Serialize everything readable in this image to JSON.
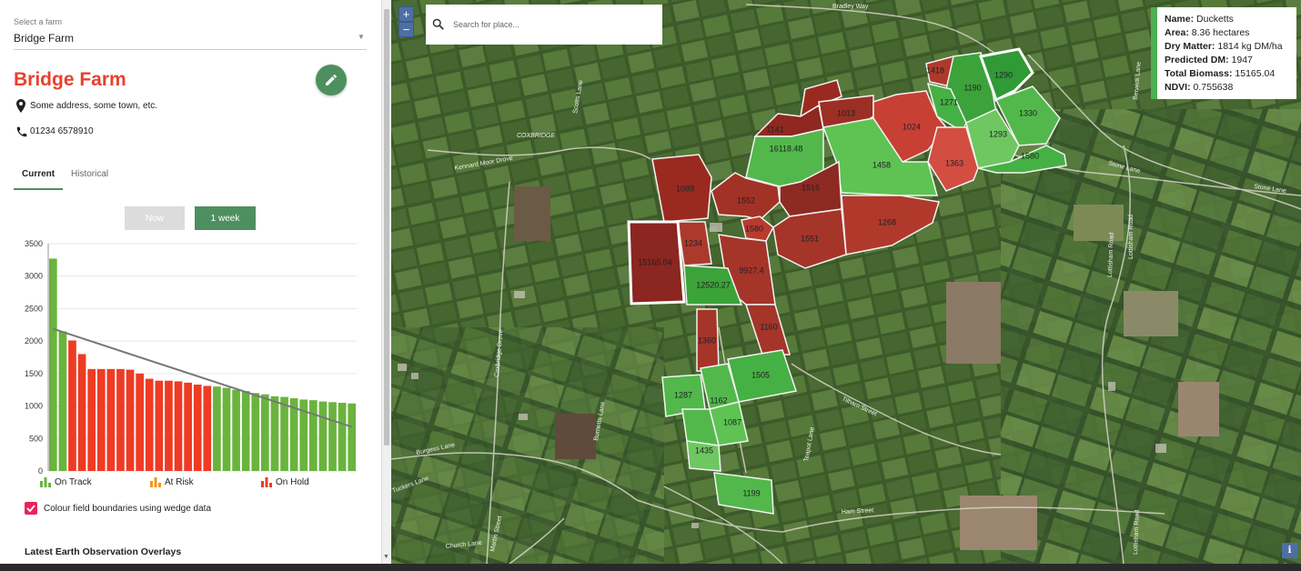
{
  "farm_select": {
    "label": "Select a farm",
    "value": "Bridge Farm"
  },
  "farm": {
    "title": "Bridge Farm",
    "address": "Some address, some town, etc.",
    "phone": "01234 6578910"
  },
  "tabs": [
    {
      "label": "Current",
      "active": true
    },
    {
      "label": "Historical",
      "active": false
    }
  ],
  "buttons": {
    "now": "Now",
    "week": "1 week"
  },
  "chart_data": {
    "type": "bar",
    "ylim": [
      0,
      3500
    ],
    "yticks": [
      "0",
      "500",
      "1000",
      "1500",
      "2000",
      "2500",
      "3000",
      "3500"
    ],
    "values": [
      3270,
      2150,
      2010,
      1800,
      1570,
      1570,
      1570,
      1570,
      1560,
      1500,
      1420,
      1390,
      1390,
      1380,
      1360,
      1330,
      1310,
      1300,
      1280,
      1250,
      1230,
      1200,
      1180,
      1150,
      1140,
      1120,
      1100,
      1090,
      1070,
      1060,
      1050,
      1040
    ],
    "statuses": [
      "green",
      "green",
      "red",
      "red",
      "red",
      "red",
      "red",
      "red",
      "red",
      "red",
      "red",
      "red",
      "red",
      "red",
      "red",
      "red",
      "red",
      "green",
      "green",
      "green",
      "green",
      "green",
      "green",
      "green",
      "green",
      "green",
      "green",
      "green",
      "green",
      "green",
      "green",
      "green"
    ],
    "trend_line": [
      [
        1,
        2190
      ],
      [
        32,
        680
      ]
    ],
    "legend": [
      "On Track",
      "At Risk",
      "On Hold"
    ],
    "colors": {
      "green": "#6ab43e",
      "red": "#ef3b24",
      "trend": "#777777",
      "at_risk": "#f7941d"
    }
  },
  "checkbox_label": "Colour field boundaries using wedge data",
  "overlays_heading": "Latest Earth Observation Overlays",
  "search": {
    "placeholder": "Search for place..."
  },
  "zoom": {
    "in": "+",
    "out": "−"
  },
  "info_card": {
    "name_label": "Name:",
    "name_value": "Ducketts",
    "area_label": "Area:",
    "area_value": "8.36 hectares",
    "dm_label": "Dry Matter:",
    "dm_value": "1814 kg DM/ha",
    "pred_label": "Predicted DM:",
    "pred_value": "1947",
    "biomass_label": "Total Biomass:",
    "biomass_value": "15165.04",
    "ndvi_label": "NDVI:",
    "ndvi_value": "0.755638"
  },
  "info_button": "i",
  "map_labels": [
    "Bradley Way",
    "Scotts Lane",
    "COXBRIDGE",
    "Kennard Moor Drove",
    "Coxbridge Drove",
    "Burgess Lane",
    "Tuckers Lane",
    "Martin Street",
    "Church Lane",
    "Ham Street",
    "Burnetts Lane",
    "Teapot Lane",
    "Tilham Street",
    "Lottisham Road",
    "Stone Lane",
    "Berwick Lane"
  ],
  "field_labels": [
    "1418",
    "1190",
    "1290",
    "1271",
    "1013",
    "1024",
    "1330",
    "1141",
    "16118.48",
    "1293",
    "1363",
    "1458",
    "1580",
    "1099",
    "1516",
    "1552",
    "1268",
    "1580",
    "1234",
    "15165.04",
    "1551",
    "9927.4",
    "12520.27",
    "1160",
    "1360",
    "1505",
    "1287",
    "1162",
    "1087",
    "1435",
    "1199"
  ]
}
